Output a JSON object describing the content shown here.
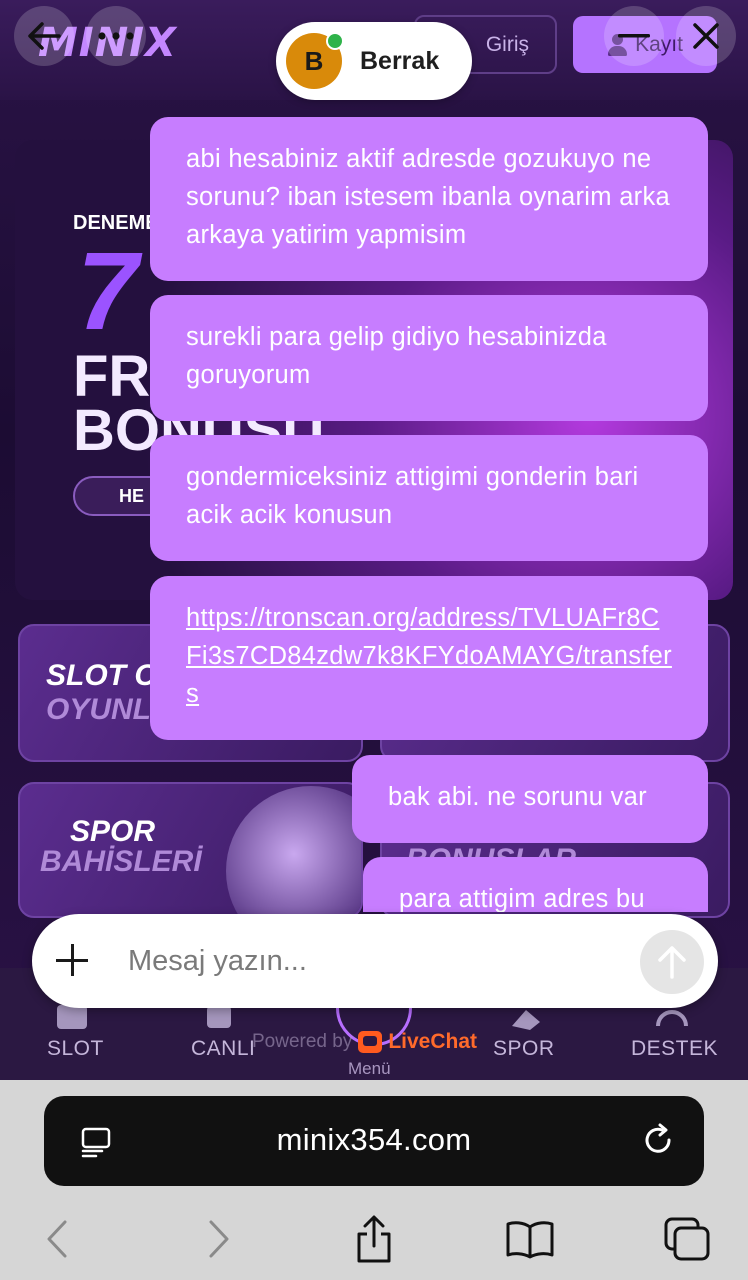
{
  "site": {
    "logo": "MINIX",
    "login_label": "Giriş",
    "register_label": "Kayıt",
    "banner": {
      "line1": "DENEME",
      "big_number": "7",
      "free_line": "FRE",
      "bonus_line": "BONUSU",
      "button_label": "HE"
    },
    "cards": {
      "slot_title_1": "SLOT CA",
      "slot_title_2": "OYUNL",
      "spor_title_1": "SPOR",
      "spor_title_2": "BAHİSLERİ",
      "bonus_title": "BONUSLAR"
    },
    "bottom_nav": {
      "slot": "SLOT",
      "canli": "CANLI",
      "menu": "Menü",
      "spor": "SPOR",
      "destek": "DESTEK"
    }
  },
  "chat": {
    "agent_initial": "B",
    "agent_name": "Berrak",
    "messages": [
      {
        "text": "abi hesabiniz aktif adresde gozukuyo ne sorunu? iban istesem ibanla oynarim arka arkaya yatirim yapmisim"
      },
      {
        "text": "surekli para gelip gidiyo hesabinizda goruyorum"
      },
      {
        "text": "gondermiceksiniz attigimi gonderin bari acik acik konusun"
      },
      {
        "text": "https://tronscan.org/address/TVLUAFr8CFi3s7CD84zdw7k8KFYdoAMAYG/transfers"
      },
      {
        "text": "bak abi. ne sorunu var"
      },
      {
        "text": "para attigim adres bu"
      }
    ],
    "composer_placeholder": "Mesaj yazın...",
    "powered_by": "Powered by",
    "livechat": "LiveChat"
  },
  "browser": {
    "url": "minix354.com"
  },
  "colors": {
    "bubble": "#c77dff",
    "accent": "#b573ff"
  }
}
